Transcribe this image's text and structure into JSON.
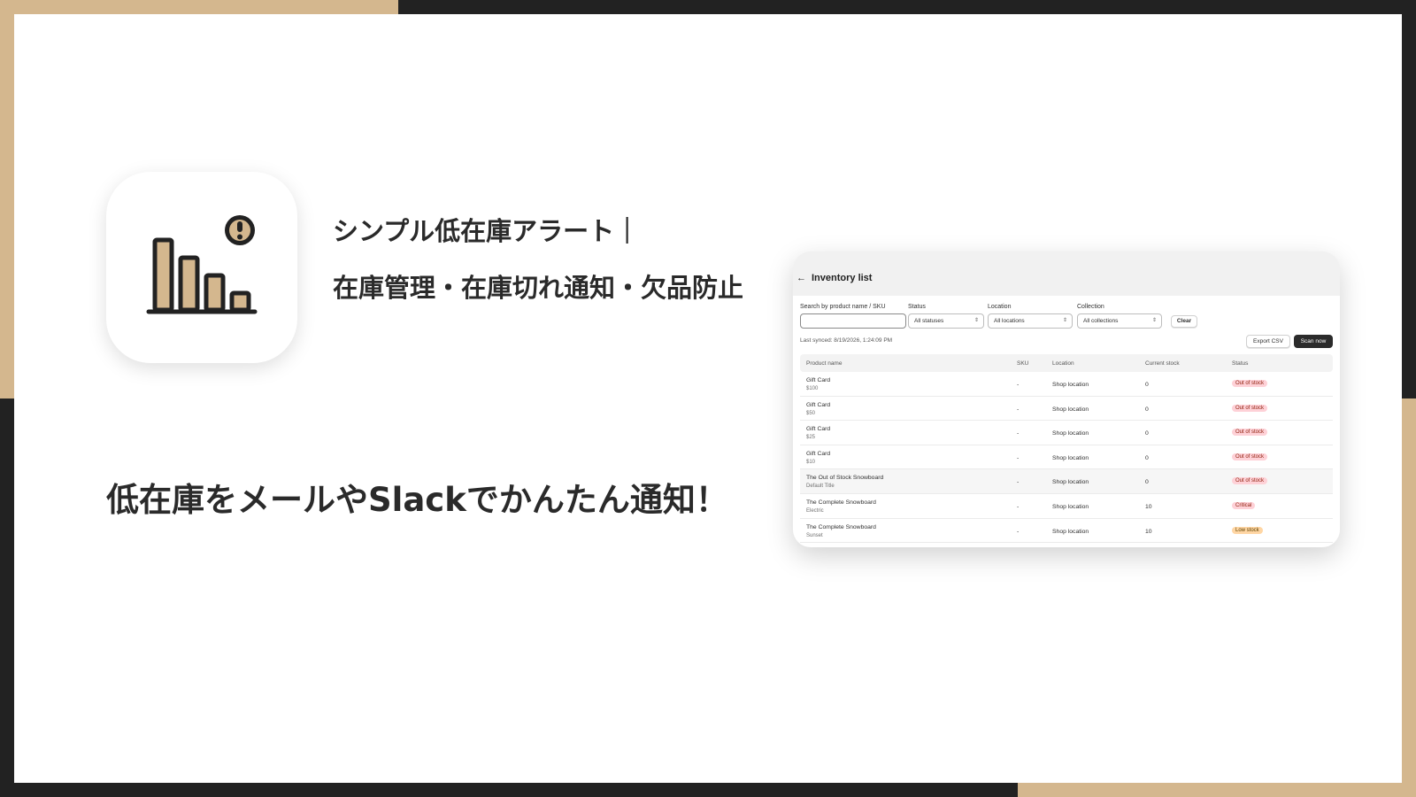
{
  "headline": {
    "line1": "シンプル低在庫アラート｜",
    "line2": "在庫管理・在庫切れ通知・欠品防止"
  },
  "tagline": "低在庫をメールやSlackでかんたん通知！",
  "colors": {
    "tan": "#d4b78e",
    "dark": "#222222",
    "icon_bar_fill": "#d4b78e"
  },
  "app_icon": {
    "name": "bar-chart-alert-icon"
  },
  "screenshot": {
    "back_arrow": "←",
    "title": "Inventory list",
    "filters": {
      "search_label": "Search by product name / SKU",
      "search_value": "",
      "status_label": "Status",
      "status_value": "All statuses",
      "location_label": "Location",
      "location_value": "All locations",
      "collection_label": "Collection",
      "collection_value": "All collections",
      "clear_label": "Clear"
    },
    "last_synced": "Last synced: 8/19/2026, 1:24:09 PM",
    "export_label": "Export CSV",
    "scan_label": "Scan now",
    "columns": [
      "Product name",
      "SKU",
      "Location",
      "Current stock",
      "Status"
    ],
    "rows": [
      {
        "name": "Gift Card",
        "variant": "$100",
        "sku": "-",
        "location": "Shop location",
        "stock": "0",
        "status": "Out of stock",
        "status_kind": "out"
      },
      {
        "name": "Gift Card",
        "variant": "$50",
        "sku": "-",
        "location": "Shop location",
        "stock": "0",
        "status": "Out of stock",
        "status_kind": "out"
      },
      {
        "name": "Gift Card",
        "variant": "$25",
        "sku": "-",
        "location": "Shop location",
        "stock": "0",
        "status": "Out of stock",
        "status_kind": "out"
      },
      {
        "name": "Gift Card",
        "variant": "$10",
        "sku": "-",
        "location": "Shop location",
        "stock": "0",
        "status": "Out of stock",
        "status_kind": "out"
      },
      {
        "name": "The Out of Stock Snowboard",
        "variant": "Default Title",
        "sku": "-",
        "location": "Shop location",
        "stock": "0",
        "status": "Out of stock",
        "status_kind": "out"
      },
      {
        "name": "The Complete Snowboard",
        "variant": "Electric",
        "sku": "-",
        "location": "Shop location",
        "stock": "10",
        "status": "Critical",
        "status_kind": "critical"
      },
      {
        "name": "The Complete Snowboard",
        "variant": "Sunset",
        "sku": "-",
        "location": "Shop location",
        "stock": "10",
        "status": "Low stock",
        "status_kind": "low"
      }
    ]
  }
}
